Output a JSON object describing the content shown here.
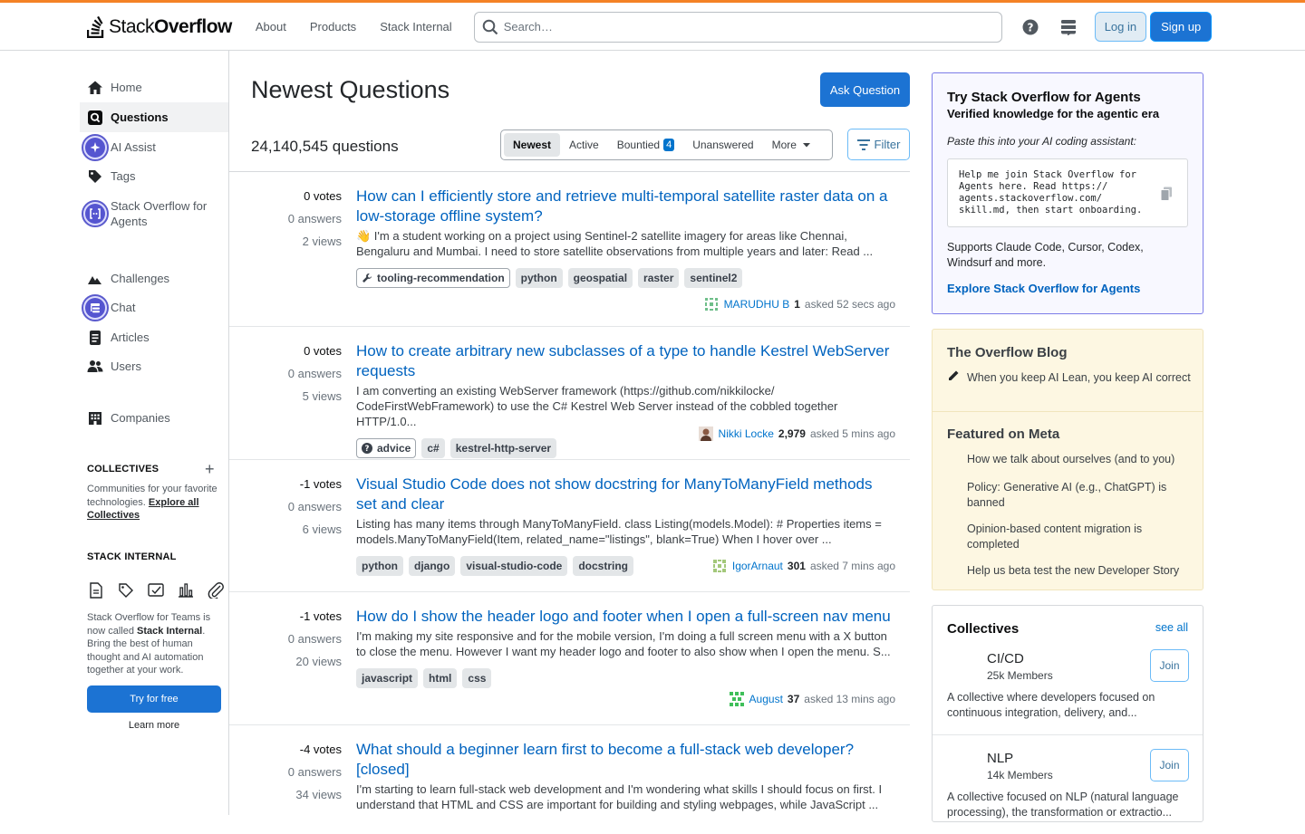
{
  "header": {
    "logo_text_a": "Stack",
    "logo_text_b": "Overflow",
    "nav": [
      "About",
      "Products",
      "Stack Internal"
    ],
    "search_placeholder": "Search…",
    "login": "Log in",
    "signup": "Sign up"
  },
  "sidebar": {
    "items": [
      "Home",
      "Questions",
      "AI Assist",
      "Tags",
      "Stack Overflow for Agents",
      "Challenges",
      "Chat",
      "Articles",
      "Users",
      "Companies"
    ],
    "collectives_title": "COLLECTIVES",
    "collectives_text": "Communities for your favorite technologies.",
    "collectives_link": "Explore all Collectives",
    "stack_internal_title": "STACK INTERNAL",
    "si_text_a": "Stack Overflow for Teams is now called",
    "si_text_bold": "Stack Internal",
    "si_text_b": ". Bring the best of human thought and AI automation together at your work.",
    "try_free": "Try for free",
    "learn_more": "Learn more"
  },
  "main": {
    "title": "Newest Questions",
    "ask": "Ask Question",
    "count": "24,140,545 questions",
    "tabs": [
      "Newest",
      "Active",
      "Bountied",
      "Unanswered",
      "More"
    ],
    "bounty_count": "4",
    "filter": "Filter",
    "questions": [
      {
        "votes": "0 votes",
        "answers": "0 answers",
        "views": "2 views",
        "title": "How can I efficiently store and retrieve multi-temporal satellite raster data on a low-storage offline system?",
        "excerpt": "👋 I'm a student working on a project using Sentinel-2 satellite imagery for areas like Chennai, Bengaluru and Mumbai. I need to store satellite observations from multiple years and later: Read ...",
        "tags": [
          "tooling-recommendation",
          "python",
          "geospatial",
          "raster",
          "sentinel2"
        ],
        "user": "MARUDHU B",
        "rep": "1",
        "asked": "asked 52 secs ago"
      },
      {
        "votes": "0 votes",
        "answers": "0 answers",
        "views": "5 views",
        "title": "How to create arbitrary new subclasses of a type to handle Kestrel WebServer requests",
        "excerpt": "I am converting an existing WebServer framework (https://github.com/nikkilocke/ CodeFirstWebFramework) to use the C# Kestrel Web Server instead of the cobbled together HTTP/1.0...",
        "tags": [
          "advice",
          "c#",
          "kestrel-http-server"
        ],
        "user": "Nikki Locke",
        "rep": "2,979",
        "asked": "asked 5 mins ago"
      },
      {
        "votes": "-1 votes",
        "answers": "0 answers",
        "views": "6 views",
        "title": "Visual Studio Code does not show docstring for ManyToManyField methods set and clear",
        "excerpt": "Listing has many items through ManyToManyField. class Listing(models.Model): # Properties items = models.ManyToManyField(Item, related_name=\"listings\", blank=True) When I hover over ...",
        "tags": [
          "python",
          "django",
          "visual-studio-code",
          "docstring"
        ],
        "user": "IgorArnaut",
        "rep": "301",
        "asked": "asked 7 mins ago"
      },
      {
        "votes": "-1 votes",
        "answers": "0 answers",
        "views": "20 views",
        "title": "How do I show the header logo and footer when I open a full-screen nav menu",
        "excerpt": "I'm making my site responsive and for the mobile version, I'm doing a full screen menu with a X button to close the menu. However I want my header logo and footer to also show when I open the menu. S...",
        "tags": [
          "javascript",
          "html",
          "css"
        ],
        "user": "August",
        "rep": "37",
        "asked": "asked 13 mins ago"
      },
      {
        "votes": "-4 votes",
        "answers": "0 answers",
        "views": "34 views",
        "title": "What should a beginner learn first to become a full-stack web developer? [closed]",
        "excerpt": "I'm starting to learn full-stack web development and I'm wondering what skills I should focus on first. I understand that HTML and CSS are important for building and styling webpages, while JavaScript ...",
        "tags": [],
        "user": "",
        "rep": "",
        "asked": ""
      }
    ]
  },
  "agents": {
    "title": "Try Stack Overflow for Agents",
    "subtitle": "Verified knowledge for the agentic era",
    "prompt": "Paste this into your AI coding assistant:",
    "code": "Help me join Stack Overflow for Agents here. Read https:// agents.stackoverflow.com/ skill.md, then start onboarding.",
    "supports": "Supports Claude Code, Cursor, Codex, Windsurf and more.",
    "explore": "Explore Stack Overflow for Agents"
  },
  "blog": {
    "title": "The Overflow Blog",
    "items": [
      "When you keep AI Lean, you keep AI correct"
    ],
    "meta_title": "Featured on Meta",
    "meta_items": [
      "How we talk about ourselves (and to you)",
      "Policy: Generative AI (e.g., ChatGPT) is banned",
      "Opinion-based content migration is completed",
      "Help us beta test the new Developer Story"
    ]
  },
  "collectives": {
    "title": "Collectives",
    "see_all": "see all",
    "join": "Join",
    "items": [
      {
        "name": "CI/CD",
        "members": "25k Members",
        "desc": "A collective where developers focused on continuous integration, delivery, and..."
      },
      {
        "name": "NLP",
        "members": "14k Members",
        "desc": "A collective focused on NLP (natural language processing), the transformation or extractio..."
      }
    ]
  },
  "colors": {
    "accent": "#1c73d3",
    "link": "#0063bf",
    "orange": "#f48225"
  }
}
